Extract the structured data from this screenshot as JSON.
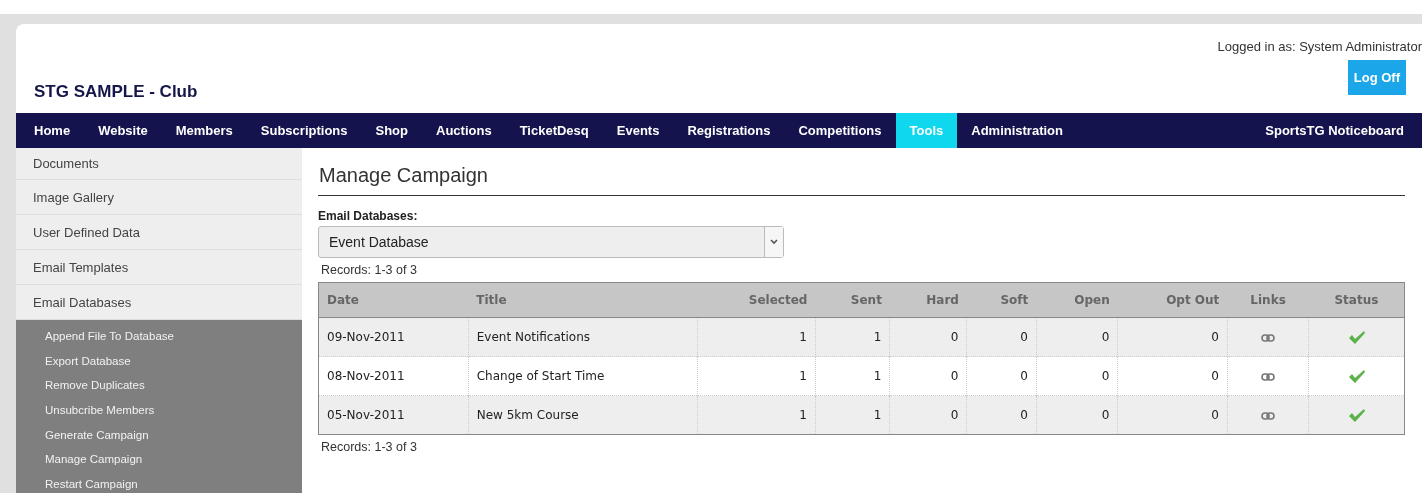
{
  "header": {
    "site_title": "STG SAMPLE - Club",
    "login_text": "Logged in as: System Administrator",
    "logoff_button": "Log Off"
  },
  "nav": {
    "items": [
      {
        "label": "Home",
        "selected": false
      },
      {
        "label": "Website",
        "selected": false
      },
      {
        "label": "Members",
        "selected": false
      },
      {
        "label": "Subscriptions",
        "selected": false
      },
      {
        "label": "Shop",
        "selected": false
      },
      {
        "label": "Auctions",
        "selected": false
      },
      {
        "label": "TicketDesq",
        "selected": false
      },
      {
        "label": "Events",
        "selected": false
      },
      {
        "label": "Registrations",
        "selected": false
      },
      {
        "label": "Competitions",
        "selected": false
      },
      {
        "label": "Tools",
        "selected": true
      },
      {
        "label": "Administration",
        "selected": false
      }
    ],
    "right_item": "SportsTG Noticeboard"
  },
  "sidebar": {
    "items": [
      {
        "label": "Documents"
      },
      {
        "label": "Image Gallery"
      },
      {
        "label": "User Defined Data"
      },
      {
        "label": "Email Templates"
      },
      {
        "label": "Email Databases",
        "children": [
          {
            "label": "Append File To Database"
          },
          {
            "label": "Export Database"
          },
          {
            "label": "Remove Duplicates"
          },
          {
            "label": "Unsubcribe Members"
          },
          {
            "label": "Generate Campaign"
          },
          {
            "label": "Manage Campaign"
          },
          {
            "label": "Restart Campaign"
          }
        ]
      }
    ]
  },
  "content": {
    "heading": "Manage Campaign",
    "select_label": "Email Databases:",
    "select_value": "Event Database",
    "records_top": "Records: 1-3 of 3",
    "records_bottom": "Records: 1-3 of 3",
    "table": {
      "columns": [
        "Date",
        "Title",
        "Selected",
        "Sent",
        "Hard",
        "Soft",
        "Open",
        "Opt Out",
        "Links",
        "Status"
      ],
      "rows": [
        {
          "date": "09-Nov-2011",
          "title": "Event Notifications",
          "selected": "1",
          "sent": "1",
          "hard": "0",
          "soft": "0",
          "open": "0",
          "opt_out": "0",
          "complete": true
        },
        {
          "date": "08-Nov-2011",
          "title": "Change of Start Time",
          "selected": "1",
          "sent": "1",
          "hard": "0",
          "soft": "0",
          "open": "0",
          "opt_out": "0",
          "complete": true
        },
        {
          "date": "05-Nov-2011",
          "title": "New 5km Course",
          "selected": "1",
          "sent": "1",
          "hard": "0",
          "soft": "0",
          "open": "0",
          "opt_out": "0",
          "complete": true
        }
      ]
    }
  }
}
